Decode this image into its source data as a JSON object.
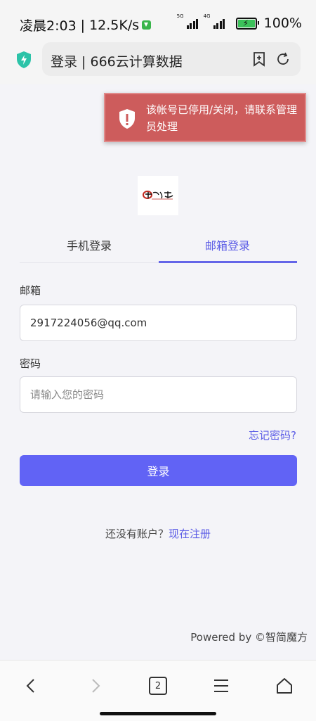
{
  "status_bar": {
    "time": "凌晨2:03",
    "separator": "|",
    "net_speed": "12.5K/s",
    "sim1_tag": "5G",
    "sim2_tag": "4G",
    "battery": "100%"
  },
  "browser": {
    "url_title": "登录 | 666云计算数据",
    "tab_count": "2",
    "icons": {
      "security": "shield-bolt-icon",
      "bookmark": "bookmark-add-icon",
      "refresh": "refresh-icon",
      "back": "chevron-left-icon",
      "forward": "chevron-right-icon",
      "menu": "hamburger-menu-icon",
      "home": "home-icon"
    }
  },
  "toast": {
    "message": "该帐号已停用/关闭，请联系管理员处理",
    "icon": "shield-exclamation-icon",
    "color": "#cd5c5c"
  },
  "login": {
    "tabs": [
      {
        "label": "手机登录",
        "active": false
      },
      {
        "label": "邮箱登录",
        "active": true
      }
    ],
    "email_label": "邮箱",
    "email_value": "2917224056@qq.com",
    "password_label": "密码",
    "password_placeholder": "请输入您的密码",
    "forgot_password": "忘记密码?",
    "submit_label": "登录",
    "signup_prompt": "还没有账户？",
    "signup_link": "现在注册",
    "accent_color": "#6163f5"
  },
  "footer": {
    "powered_by": "Powered by ©智简魔方"
  }
}
